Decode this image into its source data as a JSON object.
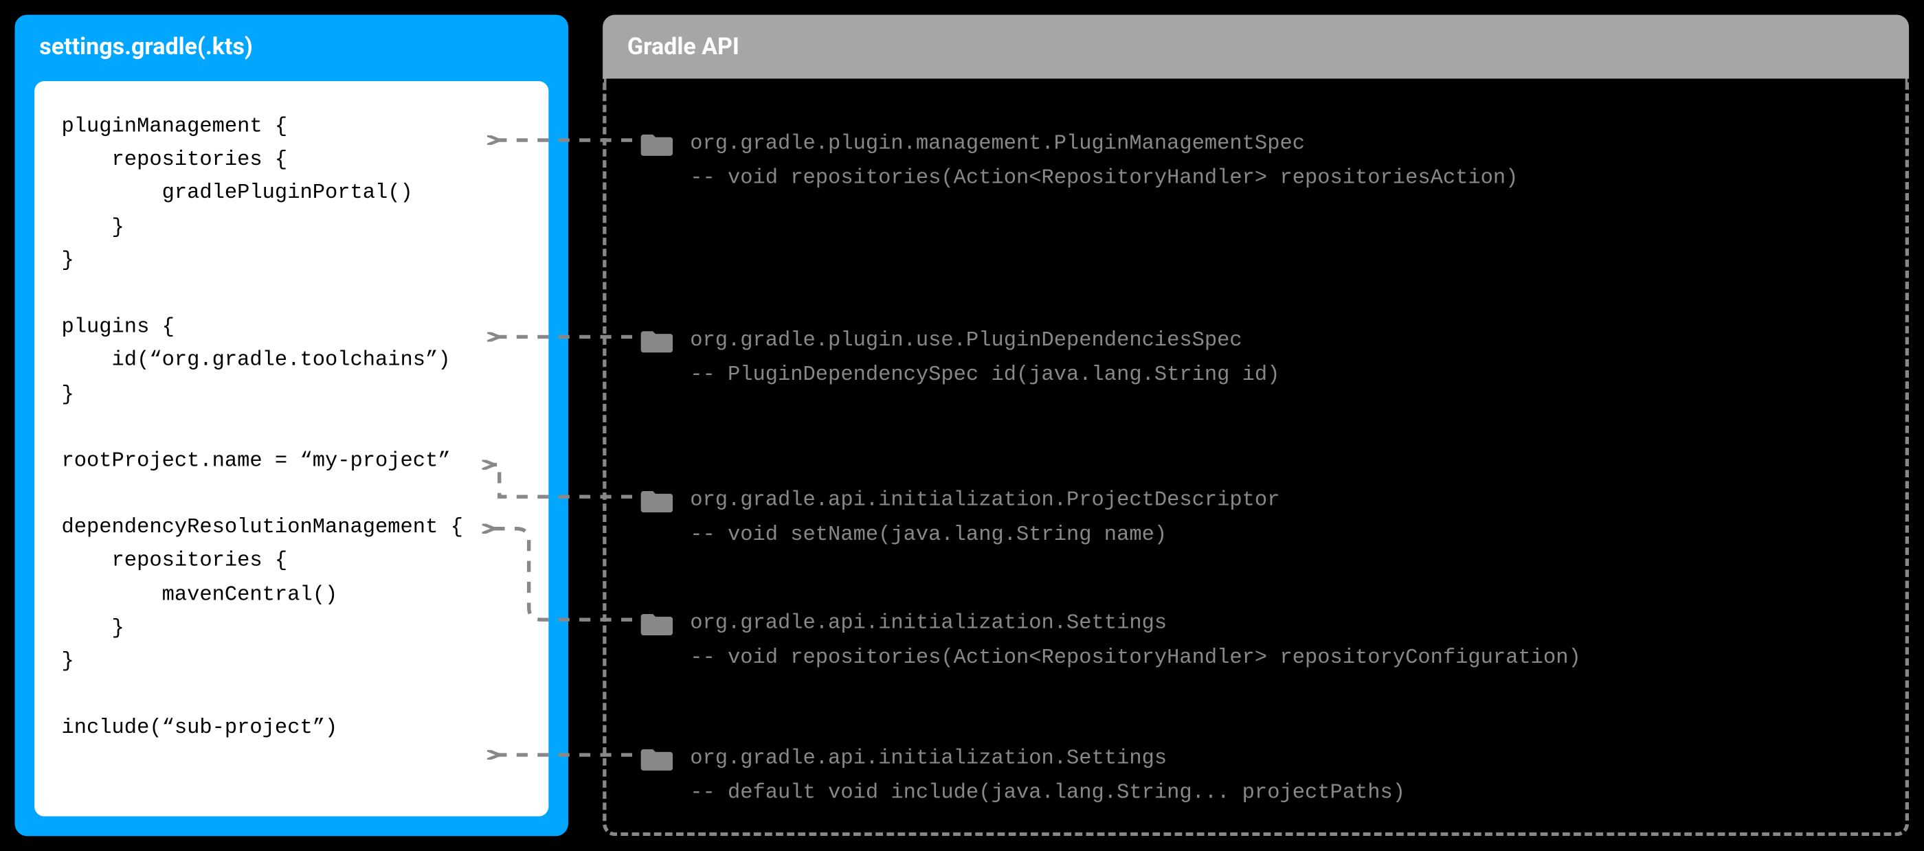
{
  "left": {
    "title": "settings.gradle(.kts)",
    "code": "pluginManagement {\n    repositories {\n        gradlePluginPortal()\n    }\n}\n\nplugins {\n    id(“org.gradle.toolchains”)\n}\n\nrootProject.name = “my-project”\n\ndependencyResolutionManagement {\n    repositories {\n        mavenCentral()\n    }\n}\n\ninclude(“sub-project”)"
  },
  "right": {
    "title": "Gradle API",
    "items": [
      {
        "class": "org.gradle.plugin.management.PluginManagementSpec",
        "method": "-- void repositories(Action<RepositoryHandler> repositoriesAction)"
      },
      {
        "class": "org.gradle.plugin.use.PluginDependenciesSpec",
        "method": "-- PluginDependencySpec id(java.lang.String id)"
      },
      {
        "class": "org.gradle.api.initialization.ProjectDescriptor",
        "method": "-- void setName(java.lang.String name)"
      },
      {
        "class": "org.gradle.api.initialization.Settings",
        "method": "-- void repositories(Action<RepositoryHandler> repositoryConfiguration)"
      },
      {
        "class": "org.gradle.api.initialization.Settings",
        "method": "-- default void include(java.lang.String... projectPaths)"
      }
    ]
  },
  "layout": {
    "code_tops": [
      0,
      1,
      2,
      3,
      4,
      5,
      6,
      7,
      8,
      9,
      10,
      11,
      12,
      13,
      14,
      15,
      16,
      17,
      18
    ],
    "api_tops": [
      40,
      200,
      330,
      430,
      540
    ]
  }
}
